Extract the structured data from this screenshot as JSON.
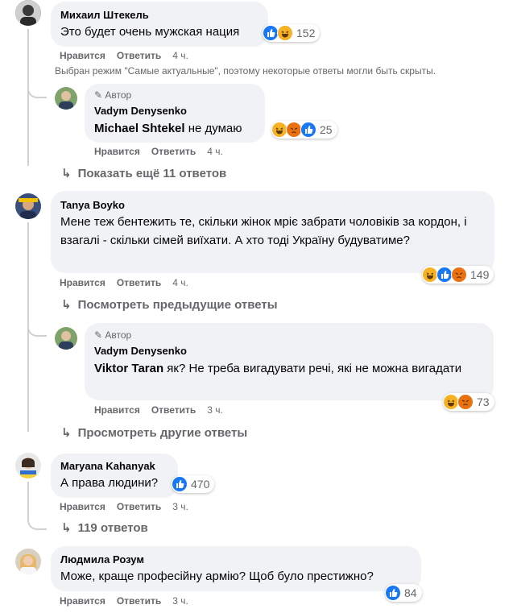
{
  "labels": {
    "like": "Нравится",
    "reply": "Ответить"
  },
  "notice": "Выбран режим \"Самые актуальные\", поэтому некоторые ответы могли быть скрыты.",
  "colors": {
    "like": "#1877f2",
    "haha": "#f7b125",
    "angry": "#e9710f",
    "meta": "#65676b",
    "bubble": "#f0f2f5"
  },
  "comments": [
    {
      "author": "Михаил Штекель",
      "text": "Это будет очень мужская нация",
      "time": "4 ч.",
      "reactions": [
        "like-icon",
        "haha-icon"
      ],
      "count": "152"
    },
    {
      "author_badge": "Автор",
      "author": "Vadym Denysenko",
      "mention": "Michael Shtekel",
      "text": " не думаю",
      "time": "4 ч.",
      "reactions": [
        "haha-icon",
        "angry-icon",
        "like-icon"
      ],
      "count": "25"
    },
    {
      "author": "Tanya Boyko",
      "text": "Мене теж бентежить те, скільки жінок мріє забрати чоловіків за кордон, і взагалі - скільки сімей виїхати. А хто тоді Україну будуватиме?",
      "time": "4 ч.",
      "reactions": [
        "haha-icon",
        "like-icon",
        "angry-icon"
      ],
      "count": "149"
    },
    {
      "author_badge": "Автор",
      "author": "Vadym Denysenko",
      "mention": "Viktor Taran",
      "text": " як? Не треба вигадувати речі, які не можна вигадати",
      "time": "3 ч.",
      "reactions": [
        "haha-icon",
        "angry-icon"
      ],
      "count": "73"
    },
    {
      "author": "Maryana Kahanyak",
      "text": "А права людини?",
      "time": "3 ч.",
      "reactions": [
        "like-icon"
      ],
      "count": "470"
    },
    {
      "author": "Людмила Розум",
      "text": "Може, краще професійну армію? Щоб було престижно?",
      "time": "3 ч.",
      "reactions": [
        "like-icon"
      ],
      "count": "84"
    }
  ],
  "more_links": {
    "show_more": "Показать ещё 11 ответов",
    "previous": "Посмотреть предыдущие ответы",
    "other": "Просмотреть другие ответы",
    "replies_119": "119 ответов"
  }
}
